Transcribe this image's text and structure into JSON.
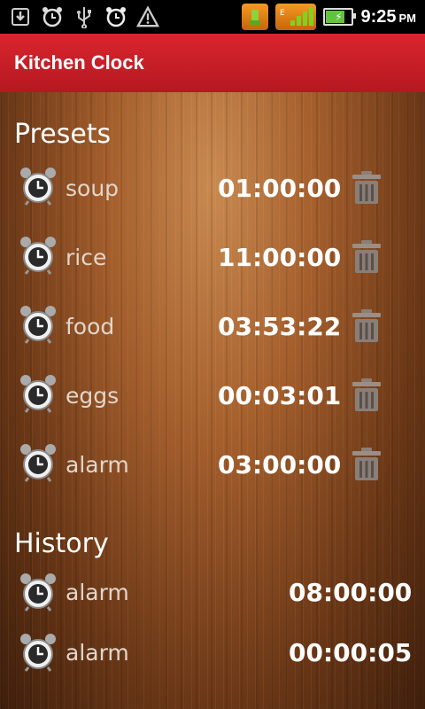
{
  "status_bar": {
    "time": "9:25",
    "ampm": "PM",
    "icons": [
      "download-icon",
      "alarm-clock-icon",
      "usb-icon",
      "alarm-clock-icon",
      "warning-icon",
      "usb-debug-icon",
      "signal-icon",
      "battery-icon"
    ]
  },
  "app": {
    "title": "Kitchen Clock",
    "accent": "#c81e27"
  },
  "presets": {
    "title": "Presets",
    "items": [
      {
        "name": "soup",
        "time": "01:00:00"
      },
      {
        "name": "rice",
        "time": "11:00:00"
      },
      {
        "name": "food",
        "time": "03:53:22"
      },
      {
        "name": "eggs",
        "time": "00:03:01"
      },
      {
        "name": "alarm",
        "time": "03:00:00"
      }
    ]
  },
  "history": {
    "title": "History",
    "items": [
      {
        "name": "alarm",
        "time": "08:00:00"
      },
      {
        "name": "alarm",
        "time": "00:00:05"
      }
    ]
  }
}
